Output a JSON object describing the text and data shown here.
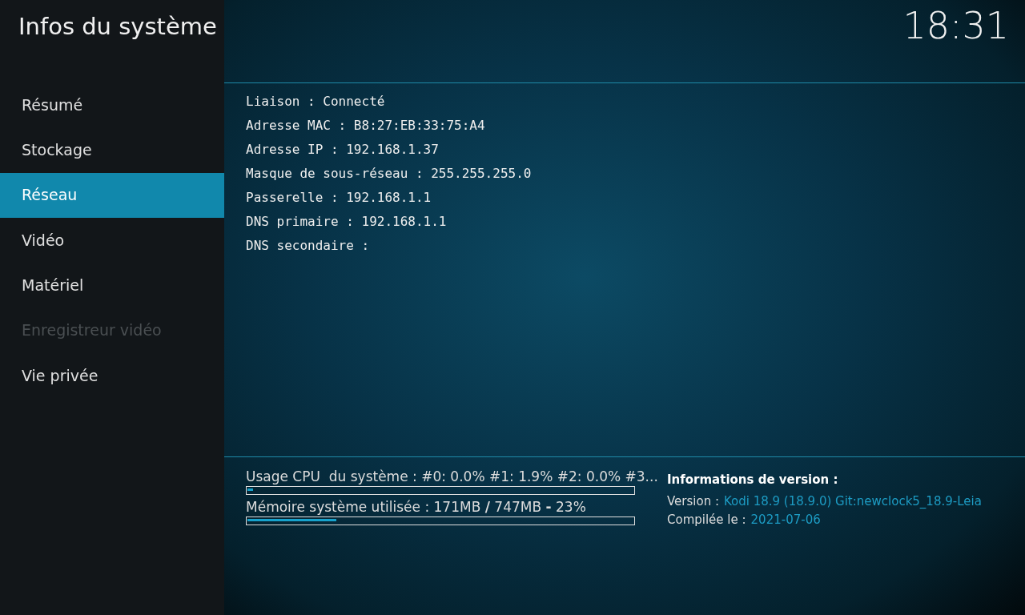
{
  "header": {
    "title": "Infos du système",
    "clock": "18:31"
  },
  "sidebar": {
    "items": [
      {
        "label": "Résumé",
        "selected": false,
        "disabled": false
      },
      {
        "label": "Stockage",
        "selected": false,
        "disabled": false
      },
      {
        "label": "Réseau",
        "selected": true,
        "disabled": false
      },
      {
        "label": "Vidéo",
        "selected": false,
        "disabled": false
      },
      {
        "label": "Matériel",
        "selected": false,
        "disabled": false
      },
      {
        "label": "Enregistreur vidéo",
        "selected": false,
        "disabled": true
      },
      {
        "label": "Vie privée",
        "selected": false,
        "disabled": false
      }
    ]
  },
  "details": [
    "Liaison : Connecté",
    "Adresse MAC : B8:27:EB:33:75:A4",
    "Adresse IP : 192.168.1.37",
    "Masque de sous-réseau : 255.255.255.0",
    "Passerelle : 192.168.1.1",
    "DNS primaire : 192.168.1.1",
    "DNS secondaire :"
  ],
  "usage": [
    {
      "label": "Usage CPU  du système : #0: 0.0% #1: 1.9% #2: 0.0% #3...",
      "level": 0.015
    },
    {
      "label": "Mémoire système utilisée : 171MB **/** 747MB **-** 23%",
      "level": 0.23
    }
  ],
  "version_info": {
    "heading": "Informations de version :",
    "rows": [
      {
        "label": "Version :",
        "value": "Kodi 18.9 (18.9.0) Git:newclock5_18.9-Leia"
      },
      {
        "label": "Compilée le :",
        "value": "2021-07-06"
      }
    ]
  }
}
